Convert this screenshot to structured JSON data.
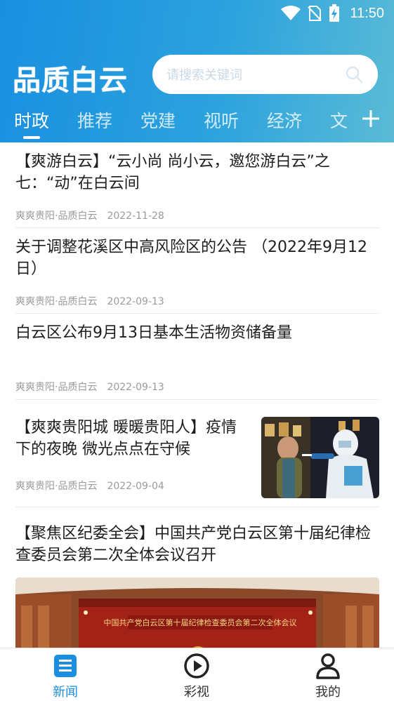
{
  "status_bar": {
    "time": "11:50",
    "icons": [
      "wifi-icon",
      "no-sim-icon",
      "battery-charging-icon"
    ]
  },
  "header": {
    "logo": "品质白云",
    "search_placeholder": "请搜索关键词",
    "tabs": [
      {
        "label": "时政",
        "active": true
      },
      {
        "label": "推荐",
        "active": false
      },
      {
        "label": "党建",
        "active": false
      },
      {
        "label": "视听",
        "active": false
      },
      {
        "label": "经济",
        "active": false
      },
      {
        "label": "文",
        "active": false
      }
    ],
    "add_tab_icon": "plus-icon"
  },
  "feed": {
    "items": [
      {
        "title": "【爽游白云】“云小尚 尚小云，邀您游白云”之七：“动”在白云间",
        "source": "爽爽贵阳·品质白云",
        "date": "2022-11-28"
      },
      {
        "title": "关于调整花溪区中高风险区的公告 （2022年9月12日）",
        "source": "爽爽贵阳·品质白云",
        "date": "2022-09-13"
      },
      {
        "title": "白云区公布9月13日基本生活物资储备量",
        "source": "爽爽贵阳·品质白云",
        "date": "2022-09-13"
      },
      {
        "title": "【爽爽贵阳城 暖暖贵阳人】疫情下的夜晚 微光点点在守候",
        "source": "爽爽贵阳·品质白云",
        "date": "2022-09-04",
        "thumbnail": "night-covid-testing-photo"
      },
      {
        "title": "【聚焦区纪委全会】中国共产党白云区第十届纪律检查委员会第二次全体会议召开",
        "image": "conference-hall-photo"
      }
    ]
  },
  "bottom_nav": {
    "items": [
      {
        "label": "新闻",
        "icon": "news-icon",
        "active": true
      },
      {
        "label": "彩视",
        "icon": "play-circle-icon",
        "active": false
      },
      {
        "label": "我的",
        "icon": "user-icon",
        "active": false
      }
    ]
  },
  "colors": {
    "header_start": "#1a8fe0",
    "header_end": "#5bbbd6",
    "active_nav": "#1a8fe0",
    "meta_text": "#9a9a9a"
  }
}
